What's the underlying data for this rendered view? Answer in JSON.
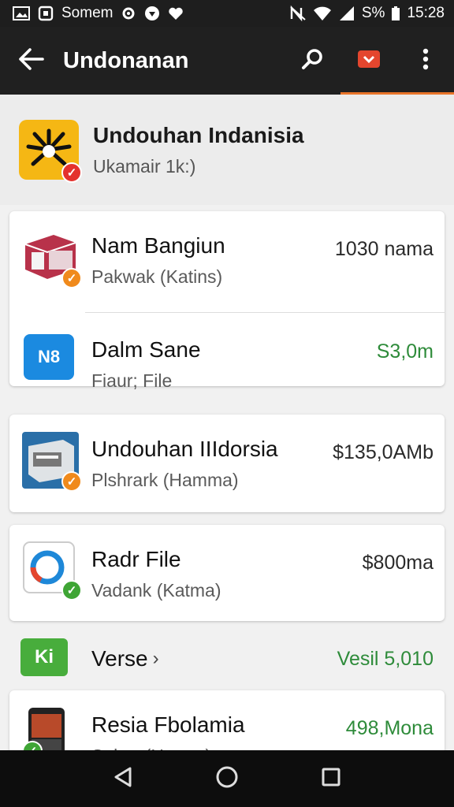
{
  "status_bar": {
    "carrier": "Somem",
    "battery": "S%",
    "time": "15:28",
    "icons": [
      "image-icon",
      "app-notification-icon",
      "settings-icon",
      "shield-icon",
      "heart-icon",
      "no-nfc-icon",
      "wifi-icon",
      "signal-icon",
      "battery-icon"
    ]
  },
  "app_bar": {
    "title": "Undonanan",
    "back_icon": "back-arrow-icon",
    "actions": [
      "search-icon",
      "download-badge-icon",
      "overflow-menu-icon"
    ],
    "accent": "#e8742a"
  },
  "header": {
    "title": "Undouhan Indanisia",
    "subtitle": "Ukamair 1k:)"
  },
  "items": [
    {
      "name": "Nam Bangiun",
      "sub": "Pakwak (Katins)",
      "value": "1030 nama",
      "value_color": "#2a2a2a",
      "badge_color": "#f08a1c"
    },
    {
      "name": "Dalm Sane",
      "sub": "Fiaur; File",
      "value": "S3,0m",
      "value_color": "#2e8b3a",
      "thumb_text": "N8"
    },
    {
      "name": "Undouhan IIIdorsia",
      "sub": "Plshrark (Hamma)",
      "value": "$135,0AMb",
      "value_color": "#2a2a2a",
      "badge_color": "#f08a1c"
    },
    {
      "name": "Radr File",
      "sub": "Vadank (Katma)",
      "value": "$800ma",
      "value_color": "#2a2a2a",
      "badge_color": "#3fa535"
    },
    {
      "name": "Verse",
      "chevron": "›",
      "value": "Vesil 5,010",
      "value_color": "#2e8b3a",
      "thumb_text": "Ki"
    },
    {
      "name": "Resia Fbolamia",
      "sub": "Sabar (Harma)",
      "value": "498,Mona",
      "value_color": "#2e8b3a",
      "badge_color": "#3fa535"
    }
  ],
  "nav_bar": {
    "icons": [
      "nav-back-icon",
      "nav-home-icon",
      "nav-recents-icon"
    ]
  }
}
